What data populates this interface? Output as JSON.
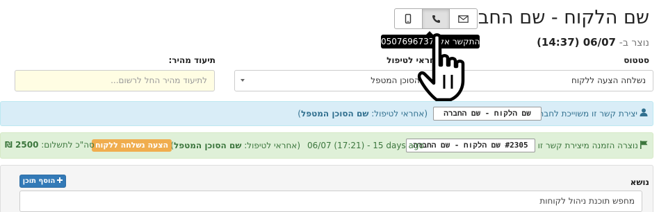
{
  "header": {
    "title": "שם הלקוח - שם החברה",
    "created_label": "נוצר ב-",
    "created_value": "06/07 (14:37)"
  },
  "contact_buttons": {
    "email_icon": "envelope-icon",
    "phone_icon": "phone-icon",
    "mobile_icon": "mobile-icon"
  },
  "tooltip": {
    "text": "התקשר אל: 0507696737"
  },
  "labels": {
    "status": "סטטוס",
    "assignee": "אחראי לטיפול",
    "quick_note": "תיעוד מהיר:"
  },
  "fields": {
    "status_value": "נשלחה הצעה ללקוח",
    "assignee_value": "שם הסוכן המטפל",
    "quick_note_placeholder": "לתיעוד מהיר החל לרשום..."
  },
  "contact_bar": {
    "prefix": "יצירת קשר זו משוייכת לחבר",
    "tag": "שם הלקוח - שם החברה",
    "assignee_prefix": "(אחראי לטיפול:",
    "assignee_name": "שם הסוכן המטפל",
    "assignee_suffix": ")"
  },
  "order_bar": {
    "prefix": "נוצרה הזמנה מיצירת קשר זו",
    "tag": "#2305 שם הלקוח - שם החברה",
    "date": "06/07 (17:21) - 15 days ago",
    "assignee_prefix": "(אחראי לטיפול:",
    "assignee_name": "שם הסוכן המטפל",
    "assignee_suffix": ")",
    "badge": "הצעה נשלחה ללקוח",
    "total_label": "סה\"כ לתשלום:",
    "total_value": "2500 ₪"
  },
  "content_panel": {
    "subject_label": "נושא",
    "add_button": "הוסף תוכן",
    "subject_value": "מחפש תוכנת ניהול לקוחות"
  },
  "colors": {
    "info_bar": "#d9edf7",
    "success_bar": "#dff0d8",
    "warning_badge": "#f0ad4e",
    "primary_button": "#337ab7",
    "quick_note_bg": "#fffde3"
  }
}
